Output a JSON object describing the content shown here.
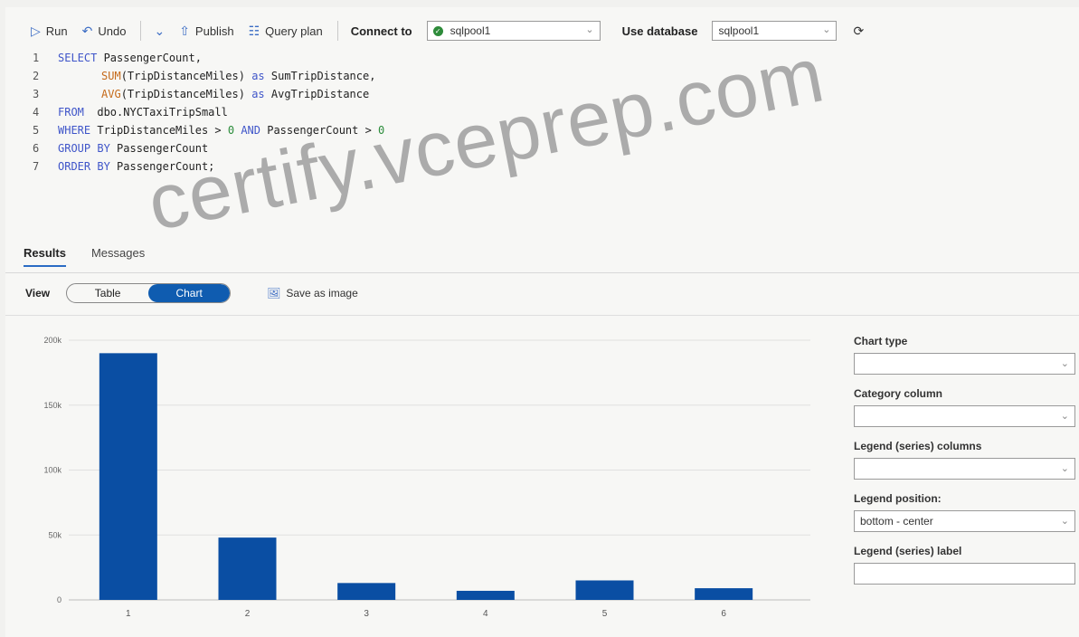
{
  "toolbar": {
    "run": "Run",
    "undo": "Undo",
    "publish": "Publish",
    "query_plan": "Query plan",
    "connect_to_label": "Connect to",
    "connect_to_value": "sqlpool1",
    "use_database_label": "Use database",
    "use_database_value": "sqlpool1"
  },
  "query": {
    "line_numbers": [
      "1",
      "2",
      "3",
      "4",
      "5",
      "6",
      "7"
    ],
    "lines": [
      {
        "kw": "SELECT",
        "rest": " PassengerCount,"
      },
      {
        "fn": "SUM",
        "rest": "(TripDistanceMiles) ",
        "as": "as",
        "tail": " SumTripDistance,"
      },
      {
        "fn": "AVG",
        "rest": "(TripDistanceMiles) ",
        "as": "as",
        "tail": " AvgTripDistance"
      },
      {
        "kw": "FROM",
        "rest": "  dbo.NYCTaxiTripSmall"
      },
      {
        "kw": "WHERE",
        "rest": " TripDistanceMiles > ",
        "n1": "0",
        "mid": " ",
        "and": "AND",
        "rest2": " PassengerCount > ",
        "n2": "0"
      },
      {
        "kw": "GROUP BY",
        "rest": " PassengerCount"
      },
      {
        "kw": "ORDER BY",
        "rest": " PassengerCount;"
      }
    ]
  },
  "results": {
    "tabs": [
      "Results",
      "Messages"
    ],
    "view_label": "View",
    "view_table": "Table",
    "view_chart": "Chart",
    "save_as_image": "Save as image"
  },
  "chart_data": {
    "type": "bar",
    "categories": [
      "1",
      "2",
      "3",
      "4",
      "5",
      "6"
    ],
    "values": [
      190000,
      48000,
      13000,
      7000,
      15000,
      9000
    ],
    "ylim": [
      0,
      200000
    ],
    "yticks": [
      "0",
      "50k",
      "100k",
      "150k",
      "200k"
    ],
    "ytick_values": [
      0,
      50000,
      100000,
      150000,
      200000
    ],
    "grid": true,
    "bar_color": "#0a4ea3"
  },
  "panel": {
    "chart_type_label": "Chart type",
    "chart_type_value": "",
    "category_column_label": "Category column",
    "category_column_value": "",
    "legend_series_label": "Legend (series) columns",
    "legend_series_value": "",
    "legend_position_label": "Legend position:",
    "legend_position_value": "bottom - center",
    "legend_series_label_label": "Legend (series) label",
    "legend_series_label_value": ""
  },
  "watermark": "certify.vceprep.com"
}
